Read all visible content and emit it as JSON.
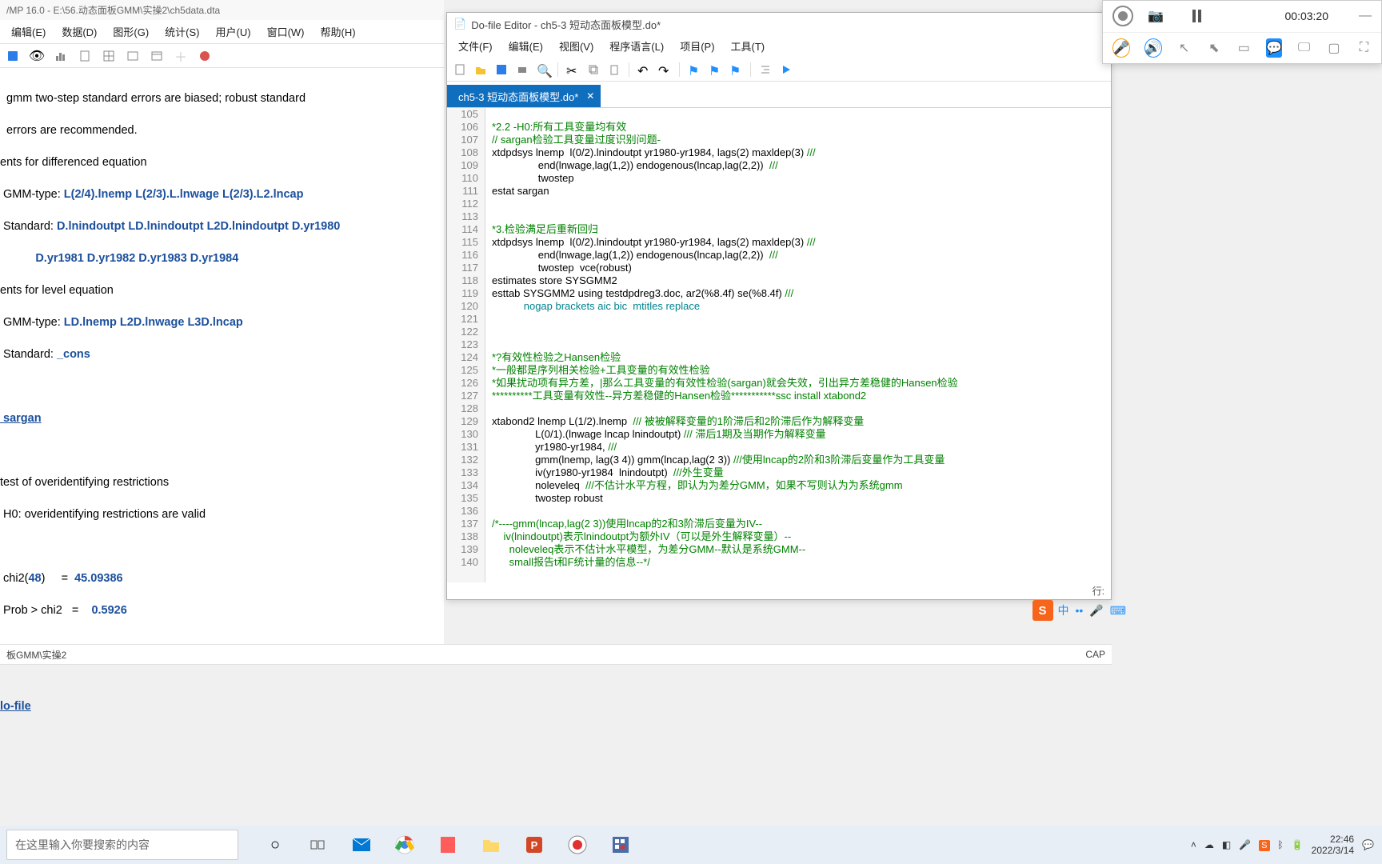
{
  "stata": {
    "title": "/MP 16.0 - E:\\56.动态面板GMM\\实操2\\ch5data.dta",
    "menu": [
      "编辑(E)",
      "数据(D)",
      "图形(G)",
      "统计(S)",
      "用户(U)",
      "窗口(W)",
      "帮助(H)"
    ],
    "output": {
      "l1": "  gmm two-step standard errors are biased; robust standard",
      "l2": "  errors are recommended.",
      "l3": "ents for differenced equation",
      "l4a": " GMM-type: ",
      "l4b": "L(2/4).lnemp L(2/3).L.lnwage L(2/3).L2.lncap",
      "l5a": " Standard: ",
      "l5b": "D.lnindoutpt LD.lnindoutpt L2D.lnindoutpt D.yr1980",
      "l6": "           D.yr1981 D.yr1982 D.yr1983 D.yr1984",
      "l7": "ents for level equation",
      "l8a": " GMM-type: ",
      "l8b": "LD.lnemp L2D.lnwage L3D.lncap",
      "l9a": " Standard: ",
      "l9b": "_cons",
      "l10": " sargan",
      "l11": "test of overidentifying restrictions",
      "l12": " H0: overidentifying restrictions are valid",
      "l13": " chi2(",
      "l13b": "48",
      "l13c": ")     =  ",
      "l13d": "45.09386",
      "l14": " Prob > chi2   =    ",
      "l14b": "0.5926",
      "l15": "lo-file"
    }
  },
  "dofile": {
    "title": "Do-file Editor - ch5-3 短动态面板模型.do*",
    "menu": [
      "文件(F)",
      "编辑(E)",
      "视图(V)",
      "程序语言(L)",
      "项目(P)",
      "工具(T)"
    ],
    "tab": "ch5-3 短动态面板模型.do*",
    "status": "行:",
    "lines": [
      {
        "n": 105,
        "t": "",
        "cls": ""
      },
      {
        "n": 106,
        "t": "*2.2 -H0:所有工具变量均有效",
        "cls": "c-green"
      },
      {
        "n": 107,
        "t": "// sargan检验工具变量过度识别问题-",
        "cls": "c-green"
      },
      {
        "n": 108,
        "t": "xtdpdsys lnemp  l(0/2).lnindoutpt yr1980-yr1984, lags(2) maxldep(3) ///",
        "cls": "c-black",
        "tail": "///"
      },
      {
        "n": 109,
        "t": "                end(lnwage,lag(1,2)) endogenous(lncap,lag(2,2))  ///",
        "cls": "c-black",
        "tail": "///"
      },
      {
        "n": 110,
        "t": "                twostep  ",
        "cls": "c-black"
      },
      {
        "n": 111,
        "t": "estat sargan",
        "cls": "c-black"
      },
      {
        "n": 112,
        "t": "",
        "cls": ""
      },
      {
        "n": 113,
        "t": "",
        "cls": ""
      },
      {
        "n": 114,
        "t": "*3.检验满足后重新回归",
        "cls": "c-green"
      },
      {
        "n": 115,
        "t": "xtdpdsys lnemp  l(0/2).lnindoutpt yr1980-yr1984, lags(2) maxldep(3) ///",
        "cls": "c-black",
        "tail": "///"
      },
      {
        "n": 116,
        "t": "                end(lnwage,lag(1,2)) endogenous(lncap,lag(2,2))  ///",
        "cls": "c-black",
        "tail": "///"
      },
      {
        "n": 117,
        "t": "                twostep  vce(robust)",
        "cls": "c-black"
      },
      {
        "n": 118,
        "t": "estimates store SYSGMM2",
        "cls": "c-black"
      },
      {
        "n": 119,
        "t": "esttab SYSGMM2 using testdpdreg3.doc, ar2(%8.4f) se(%8.4f) ///",
        "cls": "c-black",
        "tail": "///"
      },
      {
        "n": 120,
        "t": "           nogap brackets aic bic  mtitles replace",
        "cls": "c-teal"
      },
      {
        "n": 121,
        "t": "",
        "cls": ""
      },
      {
        "n": 122,
        "t": "",
        "cls": ""
      },
      {
        "n": 123,
        "t": "",
        "cls": ""
      },
      {
        "n": 124,
        "t": "*?有效性检验之Hansen检验",
        "cls": "c-green"
      },
      {
        "n": 125,
        "t": "*一般都是序列相关检验+工具变量的有效性检验",
        "cls": "c-green"
      },
      {
        "n": 126,
        "t": "*如果扰动项有异方差，|那么工具变量的有效性检验(sargan)就会失效，引出异方差稳健的Hansen检验",
        "cls": "c-green"
      },
      {
        "n": 127,
        "t": "**********工具变量有效性--异方差稳健的Hansen检验***********ssc install xtabond2",
        "cls": "c-green"
      },
      {
        "n": 128,
        "t": "",
        "cls": ""
      },
      {
        "n": 129,
        "t": "xtabond2 lnemp L(1/2).lnemp  /// 被被解释变量的1阶滞后和2阶滞后作为解释变量",
        "cls": "c-black",
        "tail": "/// 被被解释变量的1阶滞后和2阶滞后作为解释变量"
      },
      {
        "n": 130,
        "t": "               L(0/1).(lnwage lncap lnindoutpt) /// 滞后1期及当期作为解释变量",
        "cls": "c-black",
        "tail": "/// 滞后1期及当期作为解释变量"
      },
      {
        "n": 131,
        "t": "               yr1980-yr1984, ///",
        "cls": "c-black",
        "tail": "///"
      },
      {
        "n": 132,
        "t": "               gmm(lnemp, lag(3 4)) gmm(lncap,lag(2 3)) ///使用lncap的2阶和3阶滞后变量作为工具变量",
        "cls": "c-black",
        "tail": "///使用lncap的2阶和3阶滞后变量作为工具变量"
      },
      {
        "n": 133,
        "t": "               iv(yr1980-yr1984  lnindoutpt)  ///外生变量",
        "cls": "c-black",
        "tail": "///外生变量"
      },
      {
        "n": 134,
        "t": "               noleveleq  ///不估计水平方程，即认为为差分GMM，如果不写则认为为系统gmm",
        "cls": "c-black",
        "tail": "///不估计水平方程，即认为为差分GMM，如果不写则认为为系统gmm"
      },
      {
        "n": 135,
        "t": "               twostep robust",
        "cls": "c-black"
      },
      {
        "n": 136,
        "t": "",
        "cls": ""
      },
      {
        "n": 137,
        "t": "/*----gmm(lncap,lag(2 3))使用lncap的2和3阶滞后变量为IV--",
        "cls": "c-green"
      },
      {
        "n": 138,
        "t": "    iv(lnindoutpt)表示lnindoutpt为额外IV（可以是外生解释变量）--",
        "cls": "c-green"
      },
      {
        "n": 139,
        "t": "      noleveleq表示不估计水平模型，为差分GMM--默认是系统GMM--",
        "cls": "c-green"
      },
      {
        "n": 140,
        "t": "      small报告t和F统计量的信息--*/",
        "cls": "c-green"
      }
    ]
  },
  "recorder": {
    "time": "00:03:20"
  },
  "pathbar": {
    "path": "板GMM\\实操2",
    "right": "CAP"
  },
  "taskbar": {
    "search_placeholder": "在这里输入你要搜索的内容",
    "time": "22:46",
    "date": "2022/3/14"
  },
  "ime": {
    "zhong": "中"
  }
}
